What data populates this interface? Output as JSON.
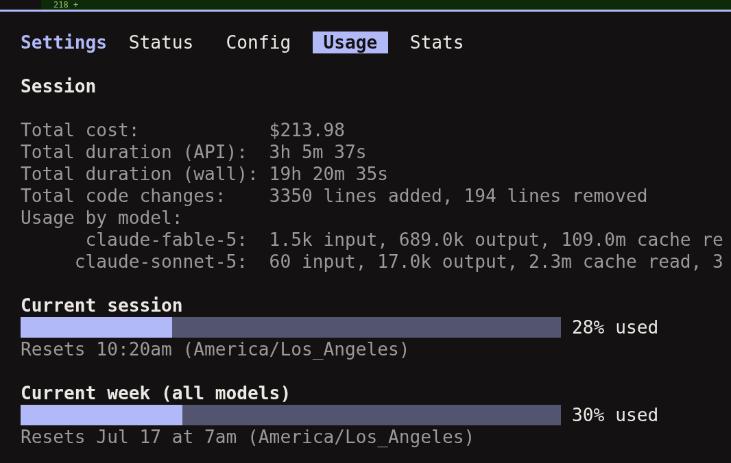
{
  "diff_line": {
    "text": "218 +"
  },
  "header": {
    "title": "Settings"
  },
  "tabs": [
    {
      "label": "Status",
      "selected": false
    },
    {
      "label": "Config",
      "selected": false
    },
    {
      "label": "Usage",
      "selected": true
    },
    {
      "label": "Stats",
      "selected": false
    }
  ],
  "session": {
    "title": "Session",
    "stats": [
      {
        "label": "Total cost:",
        "value": "$213.98"
      },
      {
        "label": "Total duration (API):",
        "value": "3h 5m 37s"
      },
      {
        "label": "Total duration (wall):",
        "value": "19h 20m 35s"
      },
      {
        "label": "Total code changes:",
        "value": "3350 lines added, 194 lines removed"
      }
    ],
    "usage_by_model": {
      "label": "Usage by model:",
      "models": [
        {
          "name": "claude-fable-5:",
          "usage": "1.5k input, 689.0k output, 109.0m cache re"
        },
        {
          "name": "claude-sonnet-5:",
          "usage": "60 input, 17.0k output, 2.3m cache read, 3"
        }
      ]
    }
  },
  "limits": [
    {
      "title": "Current session",
      "level": 0.28,
      "reading": "28% used",
      "resets": "Resets 10:20am (America/Los_Angeles)"
    },
    {
      "title": "Current week (all models)",
      "level": 0.3,
      "reading": "30% used",
      "resets": "Resets Jul 17 at 7am (America/Los_Angeles)"
    }
  ]
}
